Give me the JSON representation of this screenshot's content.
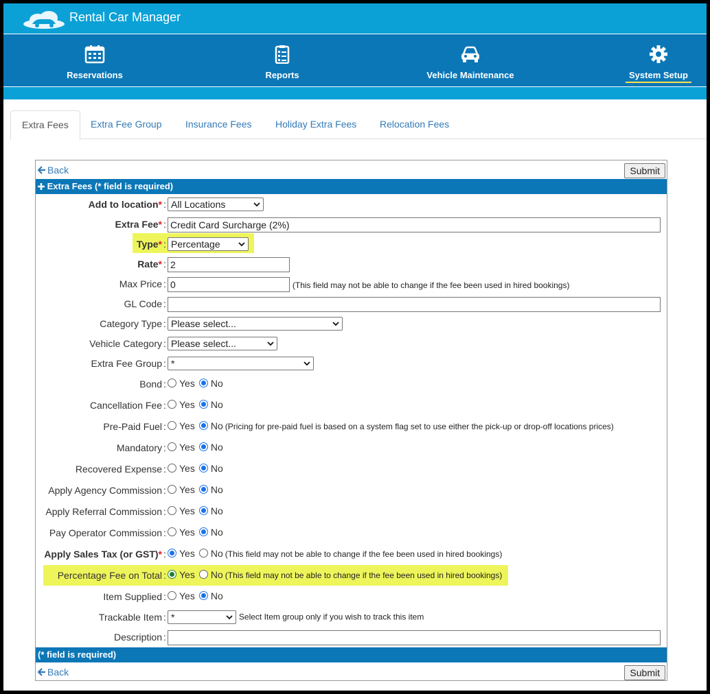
{
  "app": {
    "title": "Rental Car Manager"
  },
  "nav": [
    {
      "label": "Reservations",
      "icon": "calendar-icon"
    },
    {
      "label": "Reports",
      "icon": "clipboard-list-icon"
    },
    {
      "label": "Vehicle Maintenance",
      "icon": "car-icon"
    },
    {
      "label": "System Setup",
      "icon": "gear-icon",
      "active": true
    }
  ],
  "tabs": [
    "Extra Fees",
    "Extra Fee Group",
    "Insurance Fees",
    "Holiday Extra Fees",
    "Relocation Fees"
  ],
  "active_tab": "Extra Fees",
  "form": {
    "back_label": "Back",
    "submit_label": "Submit",
    "header": "Extra Fees (* field is required)",
    "footer": "(* field is required)",
    "required_mark": "*",
    "colon": ":",
    "yes": "Yes",
    "no": "No",
    "fields": {
      "add_to_location": {
        "label": "Add to location",
        "value": "All Locations"
      },
      "extra_fee": {
        "label": "Extra Fee",
        "value": "Credit Card Surcharge (2%)"
      },
      "type": {
        "label": "Type",
        "value": "Percentage"
      },
      "rate": {
        "label": "Rate",
        "value": "2"
      },
      "max_price": {
        "label": "Max Price",
        "value": "0",
        "note": "(This field may not be able to change if the fee been used in hired bookings)"
      },
      "gl_code": {
        "label": "GL Code",
        "value": ""
      },
      "category_type": {
        "label": "Category Type",
        "value": "Please select..."
      },
      "vehicle_category": {
        "label": "Vehicle Category",
        "value": "Please select..."
      },
      "extra_fee_group": {
        "label": "Extra Fee Group",
        "value": "*"
      },
      "bond": {
        "label": "Bond",
        "selected": "No"
      },
      "cancellation_fee": {
        "label": "Cancellation Fee",
        "selected": "No"
      },
      "pre_paid_fuel": {
        "label": "Pre-Paid Fuel",
        "selected": "No",
        "note": "(Pricing for pre-paid fuel is based on a system flag set to use either the pick-up or drop-off locations prices)"
      },
      "mandatory": {
        "label": "Mandatory",
        "selected": "No"
      },
      "recovered_expense": {
        "label": "Recovered Expense",
        "selected": "No"
      },
      "apply_agency_commission": {
        "label": "Apply Agency Commission",
        "selected": "No"
      },
      "apply_referral_commission": {
        "label": "Apply Referral Commission",
        "selected": "No"
      },
      "pay_operator_commission": {
        "label": "Pay Operator Commission",
        "selected": "No"
      },
      "apply_sales_tax": {
        "label": "Apply Sales Tax (or GST)",
        "selected": "Yes",
        "note": "(This field may not be able to change if the fee been used in hired bookings)"
      },
      "percentage_fee_on_total": {
        "label": "Percentage Fee on Total",
        "selected": "Yes",
        "note": "(This field may not be able to change if the fee been used in hired bookings)"
      },
      "item_supplied": {
        "label": "Item Supplied",
        "selected": "No"
      },
      "trackable_item": {
        "label": "Trackable Item",
        "value": "*",
        "note": "Select Item group only if you wish to track this item"
      },
      "description": {
        "label": "Description",
        "value": ""
      }
    }
  },
  "colors": {
    "top_bar": "#0ba1d6",
    "nav_bar": "#0c77b7",
    "highlight": "#eef55a",
    "link": "#337ab7",
    "active_underline": "#ffe24a"
  }
}
